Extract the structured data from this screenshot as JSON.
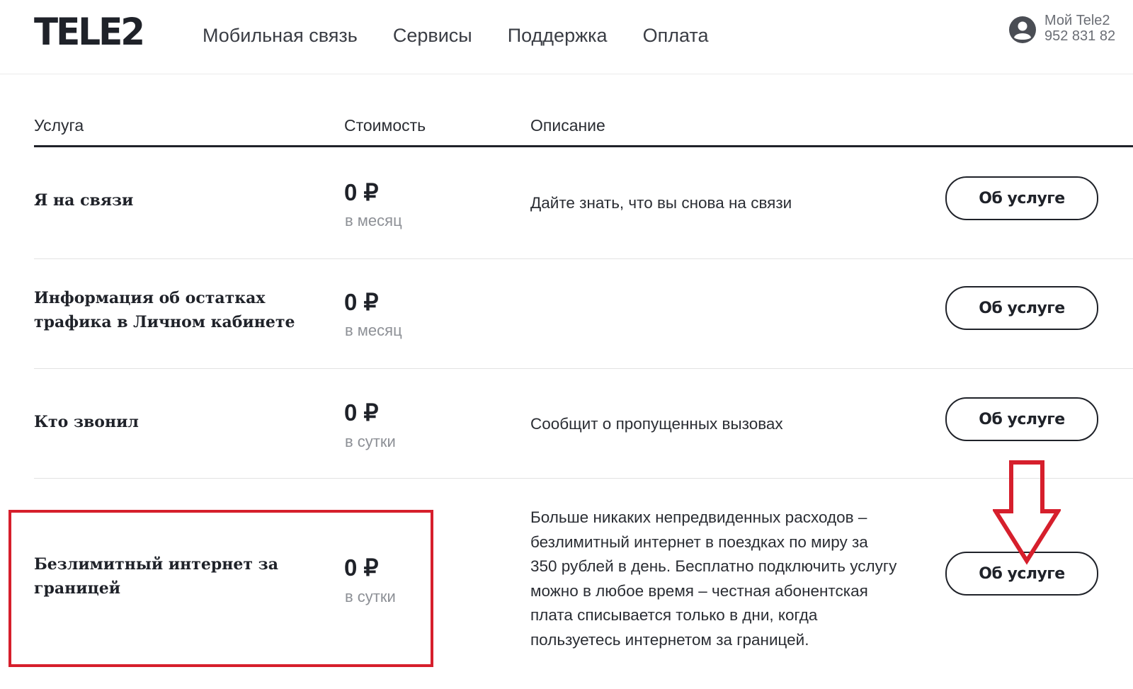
{
  "header": {
    "logo": "TELE2",
    "nav": [
      {
        "label": "Мобильная связь"
      },
      {
        "label": "Сервисы"
      },
      {
        "label": "Поддержка"
      },
      {
        "label": "Оплата"
      }
    ],
    "account": {
      "title": "Мой Tele2",
      "phone": "952 831 82"
    }
  },
  "table": {
    "columns": {
      "service": "Услуга",
      "cost": "Стоимость",
      "description": "Описание"
    },
    "rows": [
      {
        "name": "Я на связи",
        "price": "0 ₽",
        "period": "в месяц",
        "description": "Дайте знать, что вы снова на связи",
        "button": "Об услуге"
      },
      {
        "name": "Информация об остатках трафика в Личном кабинете",
        "price": "0 ₽",
        "period": "в месяц",
        "description": "",
        "button": "Об услуге"
      },
      {
        "name": "Кто звонил",
        "price": "0 ₽",
        "period": "в сутки",
        "description": "Сообщит о пропущенных вызовах",
        "button": "Об услуге"
      },
      {
        "name": "Безлимитный интернет за границей",
        "price": "0 ₽",
        "period": "в сутки",
        "description": "Больше никаких непредвиденных расходов – безлимитный интернет в поездках по миру за 350 рублей в день. Бесплатно подключить услугу можно в любое время – честная абонентская плата списывается только в дни, когда пользуетесь интернетом за границей.",
        "button": "Об услуге"
      }
    ]
  },
  "annotations": {
    "highlight_color": "#d61f2c",
    "arrow_color": "#d61f2c"
  }
}
